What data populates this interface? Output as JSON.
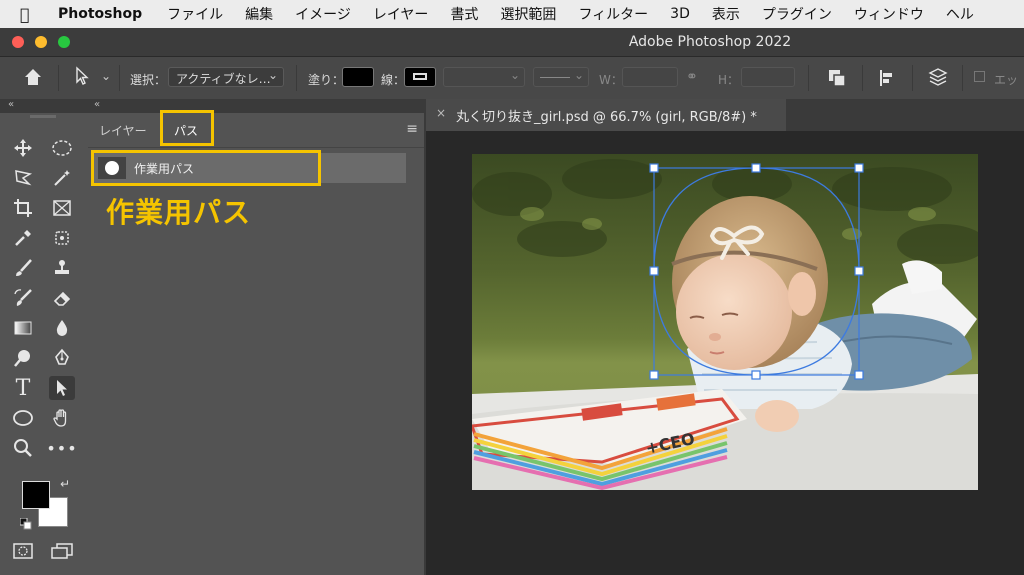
{
  "menubar": {
    "app_name": "Photoshop",
    "items": [
      "ファイル",
      "編集",
      "イメージ",
      "レイヤー",
      "書式",
      "選択範囲",
      "フィルター",
      "3D",
      "表示",
      "プラグイン",
      "ウィンドウ",
      "ヘル"
    ]
  },
  "window": {
    "title": "Adobe Photoshop 2022"
  },
  "options": {
    "select_label": "選択：",
    "select_value": "アクティブなレ…",
    "fill_label": "塗り：",
    "stroke_label": "線：",
    "w_label": "W：",
    "h_label": "H：",
    "cut_label": "エッ"
  },
  "panel": {
    "tab_layers": "レイヤー",
    "tab_paths": "パス",
    "path_item": "作業用パス",
    "callout": "作業用パス"
  },
  "document": {
    "tab_title": "丸く切り抜き_girl.psd @ 66.7% (girl, RGB/8#) *"
  },
  "colors": {
    "highlight": "#f5c400",
    "selection_path": "#3d7be0"
  }
}
